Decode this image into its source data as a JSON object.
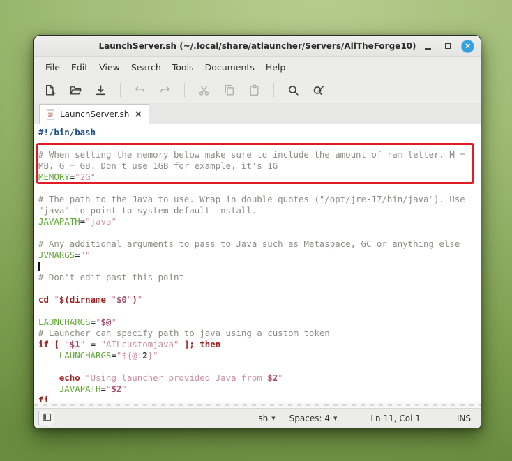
{
  "window": {
    "title": "LaunchServer.sh (~/.local/share/atlauncher/Servers/AllTheForge10)",
    "close_glyph": "×"
  },
  "menu": {
    "items": [
      "File",
      "Edit",
      "View",
      "Search",
      "Tools",
      "Documents",
      "Help"
    ]
  },
  "toolbar": {
    "buttons": [
      {
        "name": "new-file",
        "enabled": true
      },
      {
        "name": "open-folder",
        "enabled": true
      },
      {
        "name": "save",
        "enabled": true
      },
      {
        "separator": true
      },
      {
        "name": "undo",
        "enabled": false
      },
      {
        "name": "redo",
        "enabled": false
      },
      {
        "separator": true
      },
      {
        "name": "cut",
        "enabled": false
      },
      {
        "name": "copy",
        "enabled": false
      },
      {
        "name": "paste",
        "enabled": false
      },
      {
        "separator": true
      },
      {
        "name": "search",
        "enabled": true
      },
      {
        "name": "search-replace",
        "enabled": true
      }
    ]
  },
  "tabbar": {
    "tabs": [
      {
        "label": "LaunchServer.sh",
        "active": true,
        "close_glyph": "×"
      }
    ]
  },
  "editor": {
    "lines": [
      [
        {
          "t": "#!/bin/bash",
          "c": "shb"
        }
      ],
      [],
      [
        {
          "t": "# When setting the memory below make sure to include the amount of ram letter. M =",
          "c": "cmt"
        }
      ],
      [
        {
          "t": "MB, G = GB. Don't use 1GB for example, it's 1G",
          "c": "cmt"
        }
      ],
      [
        {
          "t": "MEMORY",
          "c": "var"
        },
        {
          "t": "=",
          "c": "pln"
        },
        {
          "t": "\"2G\"",
          "c": "str"
        }
      ],
      [],
      [
        {
          "t": "# The path to the Java to use. Wrap in double quotes (\"/opt/jre-17/bin/java\"). Use",
          "c": "cmt"
        }
      ],
      [
        {
          "t": "\"java\" to point to system default install.",
          "c": "cmt"
        }
      ],
      [
        {
          "t": "JAVAPATH",
          "c": "var"
        },
        {
          "t": "=",
          "c": "pln"
        },
        {
          "t": "\"java\"",
          "c": "str"
        }
      ],
      [],
      [
        {
          "t": "# Any additional arguments to pass to Java such as Metaspace, GC or anything else",
          "c": "cmt"
        }
      ],
      [
        {
          "t": "JVMARGS",
          "c": "var"
        },
        {
          "t": "=",
          "c": "pln"
        },
        {
          "t": "\"\"",
          "c": "str"
        }
      ],
      [
        {
          "caret": true
        }
      ],
      [
        {
          "t": "# Don't edit past this point",
          "c": "cmt"
        }
      ],
      [],
      [
        {
          "t": "cd",
          "c": "kw"
        },
        {
          "t": " ",
          "c": "pln"
        },
        {
          "t": "\"",
          "c": "str"
        },
        {
          "t": "$(dirname",
          "c": "kw"
        },
        {
          "t": " ",
          "c": "pln"
        },
        {
          "t": "\"",
          "c": "str"
        },
        {
          "t": "$0",
          "c": "vsub"
        },
        {
          "t": "\"",
          "c": "str"
        },
        {
          "t": ")",
          "c": "kw"
        },
        {
          "t": "\"",
          "c": "str"
        }
      ],
      [],
      [
        {
          "t": "LAUNCHARGS",
          "c": "var"
        },
        {
          "t": "=",
          "c": "pln"
        },
        {
          "t": "\"",
          "c": "str"
        },
        {
          "t": "$@",
          "c": "vsub"
        },
        {
          "t": "\"",
          "c": "str"
        }
      ],
      [
        {
          "t": "# Launcher can specify path to java using a custom token",
          "c": "cmt"
        }
      ],
      [
        {
          "t": "if",
          "c": "kw"
        },
        {
          "t": " ",
          "c": "pln"
        },
        {
          "t": "[",
          "c": "kw"
        },
        {
          "t": " ",
          "c": "pln"
        },
        {
          "t": "\"",
          "c": "str"
        },
        {
          "t": "$1",
          "c": "vsub"
        },
        {
          "t": "\"",
          "c": "str"
        },
        {
          "t": " = ",
          "c": "pln"
        },
        {
          "t": "\"ATLcustomjava\"",
          "c": "str"
        },
        {
          "t": " ",
          "c": "pln"
        },
        {
          "t": "];",
          "c": "kw"
        },
        {
          "t": " ",
          "c": "pln"
        },
        {
          "t": "then",
          "c": "kw"
        }
      ],
      [
        {
          "t": "    ",
          "c": "pln"
        },
        {
          "t": "LAUNCHARGS",
          "c": "var"
        },
        {
          "t": "=",
          "c": "pln"
        },
        {
          "t": "\"${@:",
          "c": "str"
        },
        {
          "t": "2",
          "c": "bld"
        },
        {
          "t": "}\"",
          "c": "str"
        }
      ],
      [],
      [
        {
          "t": "    ",
          "c": "pln"
        },
        {
          "t": "echo",
          "c": "kw"
        },
        {
          "t": " ",
          "c": "pln"
        },
        {
          "t": "\"Using launcher provided Java from ",
          "c": "str"
        },
        {
          "t": "$2",
          "c": "vsub"
        },
        {
          "t": "\"",
          "c": "str"
        }
      ],
      [
        {
          "t": "    ",
          "c": "pln"
        },
        {
          "t": "JAVAPATH",
          "c": "var"
        },
        {
          "t": "=",
          "c": "pln"
        },
        {
          "t": "\"",
          "c": "str"
        },
        {
          "t": "$2",
          "c": "vsub"
        },
        {
          "t": "\"",
          "c": "str"
        }
      ],
      [
        {
          "t": "fi",
          "c": "kw"
        }
      ]
    ]
  },
  "annotation": {
    "type": "highlight-box",
    "color": "#e01b24"
  },
  "statusbar": {
    "language": "sh",
    "spaces": "Spaces: 4",
    "position": "Ln 11, Col 1",
    "mode": "INS",
    "chevron": "▼"
  }
}
